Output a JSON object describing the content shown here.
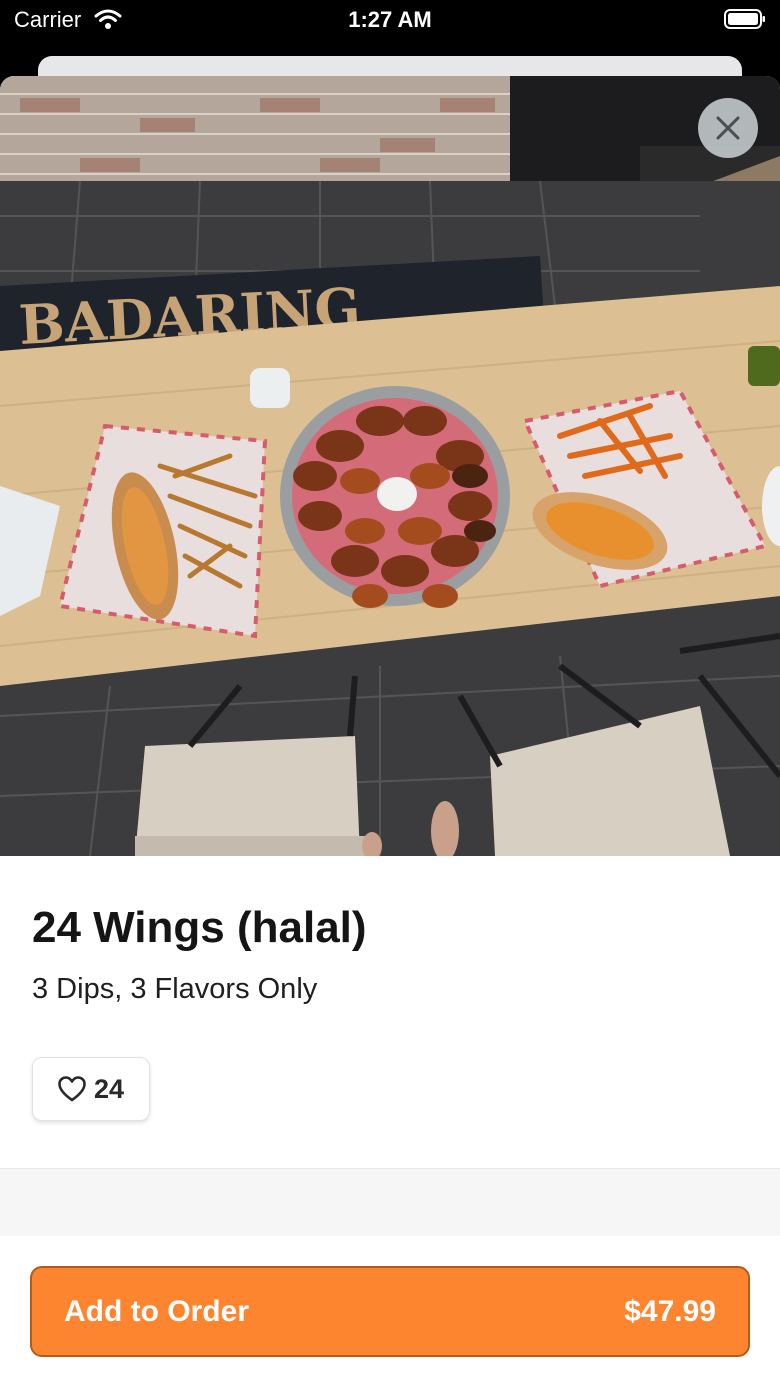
{
  "status_bar": {
    "carrier": "Carrier",
    "time": "1:27 AM"
  },
  "item": {
    "title": "24 Wings (halal)",
    "description": "3 Dips, 3 Flavors Only",
    "likes": "24"
  },
  "footer": {
    "add_label": "Add to Order",
    "price": "$47.99"
  },
  "colors": {
    "accent": "#fd8530",
    "accent_border": "#b85a14"
  },
  "icons": {
    "close": "close-icon",
    "like": "heart-icon",
    "wifi": "wifi-icon",
    "battery": "battery-icon"
  }
}
